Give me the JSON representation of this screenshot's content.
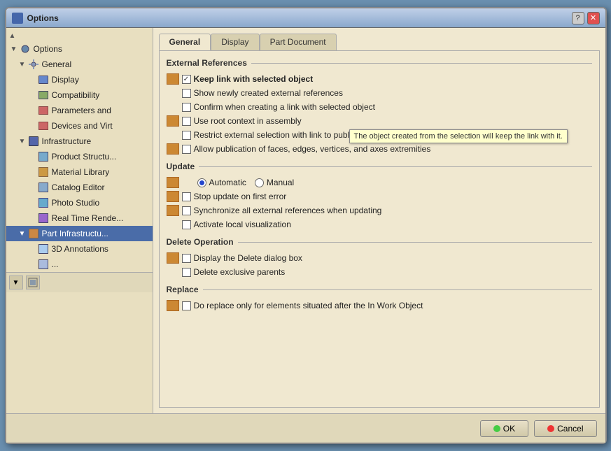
{
  "window": {
    "title": "Options",
    "close_btn": "✕",
    "help_btn": "?",
    "minimize_btn": "−"
  },
  "sidebar": {
    "items": [
      {
        "id": "scroll-up",
        "label": "▲",
        "indent": 0,
        "type": "scroll"
      },
      {
        "id": "options-root",
        "label": "Options",
        "indent": 0,
        "type": "root",
        "icon": "gear"
      },
      {
        "id": "general",
        "label": "General",
        "indent": 1,
        "type": "node",
        "icon": "gear",
        "expanded": true
      },
      {
        "id": "display",
        "label": "Display",
        "indent": 2,
        "type": "leaf",
        "icon": "display"
      },
      {
        "id": "compatibility",
        "label": "Compatibility",
        "indent": 2,
        "type": "leaf",
        "icon": "compat"
      },
      {
        "id": "parameters",
        "label": "Parameters and",
        "indent": 2,
        "type": "leaf",
        "icon": "param"
      },
      {
        "id": "devices",
        "label": "Devices and Virt",
        "indent": 2,
        "type": "leaf",
        "icon": "param"
      },
      {
        "id": "infrastructure",
        "label": "Infrastructure",
        "indent": 1,
        "type": "node",
        "icon": "infra",
        "expanded": true
      },
      {
        "id": "product",
        "label": "Product Structu...",
        "indent": 2,
        "type": "leaf",
        "icon": "product"
      },
      {
        "id": "material",
        "label": "Material Library",
        "indent": 2,
        "type": "leaf",
        "icon": "material"
      },
      {
        "id": "catalog",
        "label": "Catalog Editor",
        "indent": 2,
        "type": "leaf",
        "icon": "catalog"
      },
      {
        "id": "photo",
        "label": "Photo Studio",
        "indent": 2,
        "type": "leaf",
        "icon": "photo"
      },
      {
        "id": "render",
        "label": "Real Time Rende...",
        "indent": 2,
        "type": "leaf",
        "icon": "render"
      },
      {
        "id": "part-infra",
        "label": "Part Infrastructu...",
        "indent": 1,
        "type": "node",
        "icon": "part",
        "selected": true
      },
      {
        "id": "annotations",
        "label": "3D Annotations",
        "indent": 2,
        "type": "leaf",
        "icon": "3d"
      }
    ]
  },
  "tabs": [
    {
      "id": "general",
      "label": "General",
      "active": true
    },
    {
      "id": "display",
      "label": "Display",
      "active": false
    },
    {
      "id": "part-document",
      "label": "Part Document",
      "active": false
    }
  ],
  "sections": {
    "external_references": {
      "title": "External References",
      "options": [
        {
          "id": "keep-link",
          "label": "Keep link with selected object",
          "checked": true,
          "bold": true,
          "has_icon": true
        },
        {
          "id": "show-newly",
          "label": "Show newly created external references",
          "checked": false,
          "has_icon": false
        },
        {
          "id": "confirm-link",
          "label": "Confirm when creating a link with selected object",
          "checked": false,
          "has_icon": false
        },
        {
          "id": "use-root",
          "label": "Use root context in assembly",
          "checked": false,
          "has_icon": true
        },
        {
          "id": "restrict-selection",
          "label": "Restrict external selection with link to published elements",
          "checked": false,
          "has_icon": false
        },
        {
          "id": "allow-publication",
          "label": "Allow publication of faces, edges, vertices, and axes extremities",
          "checked": false,
          "has_icon": true
        }
      ]
    },
    "update": {
      "title": "Update",
      "options": [
        {
          "id": "update-mode",
          "type": "radio",
          "has_icon": true
        },
        {
          "id": "stop-update",
          "label": "Stop update on first error",
          "checked": false,
          "has_icon": true
        },
        {
          "id": "sync-external",
          "label": "Synchronize all external references when updating",
          "checked": false,
          "has_icon": true
        },
        {
          "id": "activate-local",
          "label": "Activate local visualization",
          "checked": false,
          "has_icon": false
        }
      ],
      "radio_options": [
        {
          "id": "automatic",
          "label": "Automatic",
          "selected": true
        },
        {
          "id": "manual",
          "label": "Manual",
          "selected": false
        }
      ]
    },
    "delete_operation": {
      "title": "Delete Operation",
      "options": [
        {
          "id": "display-delete",
          "label": "Display the Delete dialog box",
          "checked": false,
          "has_icon": true
        },
        {
          "id": "delete-exclusive",
          "label": "Delete exclusive parents",
          "checked": false,
          "has_icon": false
        }
      ]
    },
    "replace": {
      "title": "Replace",
      "options": [
        {
          "id": "do-replace",
          "label": "Do replace only for elements situated after the In Work Object",
          "checked": false,
          "has_icon": true
        }
      ]
    }
  },
  "tooltip": {
    "text": "The object created from the selection will keep the link with it."
  },
  "buttons": {
    "ok": "OK",
    "cancel": "Cancel"
  }
}
